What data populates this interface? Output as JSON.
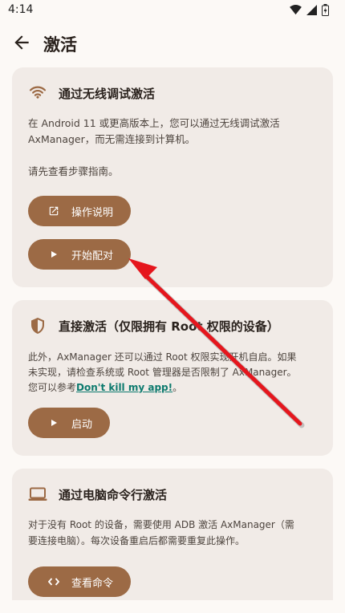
{
  "status_bar": {
    "time": "4:14"
  },
  "app_bar": {
    "title": "激活"
  },
  "card_wireless": {
    "title": "通过无线调试激活",
    "desc_line1": "在 Android 11 或更高版本上，您可以通过无线调试激活",
    "desc_line2": "AxManager，而无需连接到计算机。",
    "desc_line3": "请先查看步骤指南。",
    "btn_guide": "操作说明",
    "btn_pair": "开始配对"
  },
  "card_root": {
    "title": "直接激活（仅限拥有 Root 权限的设备）",
    "desc_line1": "此外，AxManager 还可以通过 Root 权限实现开机自启。如果",
    "desc_line2": "未实现，请检查系统或 Root 管理器是否限制了 AxManager。",
    "desc_line3_prefix": "您可以参考",
    "desc_link": "Don't kill my app!",
    "desc_line3_suffix": "。",
    "btn_start": "启动"
  },
  "card_adb": {
    "title": "通过电脑命令行激活",
    "desc_line1": "对于没有 Root 的设备，需要使用 ADB 激活 AxManager（需",
    "desc_line2": "要连接电脑）。每次设备重启后都需要重复此操作。",
    "btn_view": "查看命令"
  },
  "colors": {
    "accent": "#9c6a45",
    "card_bg": "#f1ebe7",
    "link": "#0d7a6e",
    "arrow": "#e5161d"
  },
  "icons": [
    "wifi-icon",
    "cellular-icon",
    "battery-icon",
    "back-arrow-icon",
    "external-link-icon",
    "play-icon",
    "shield-icon",
    "laptop-icon",
    "code-icon"
  ]
}
